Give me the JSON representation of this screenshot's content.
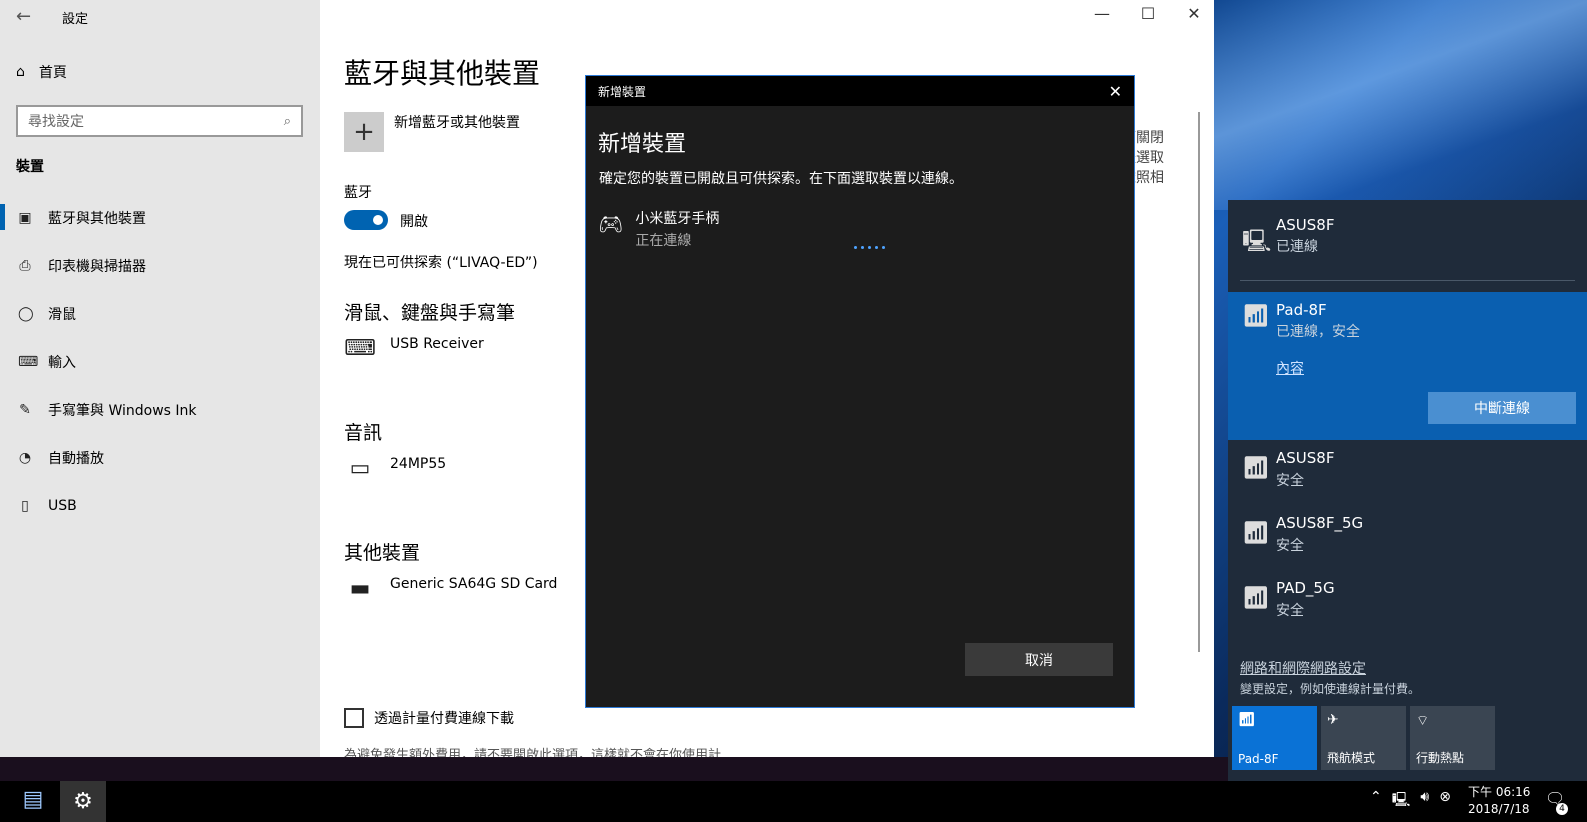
{
  "settings": {
    "window_title": "設定",
    "home_label": "首頁",
    "search_placeholder": "尋找設定",
    "section_title": "裝置",
    "nav_items": [
      {
        "label": "藍牙與其他裝置",
        "icon": "bluetooth-devices-icon"
      },
      {
        "label": "印表機與掃描器",
        "icon": "printer-icon"
      },
      {
        "label": "滑鼠",
        "icon": "mouse-icon"
      },
      {
        "label": "輸入",
        "icon": "keyboard-icon"
      },
      {
        "label": "手寫筆與 Windows Ink",
        "icon": "pen-icon"
      },
      {
        "label": "自動播放",
        "icon": "autoplay-icon"
      },
      {
        "label": "USB",
        "icon": "usb-icon"
      }
    ],
    "page_title": "藍牙與其他裝置",
    "add_device_label": "新增藍牙或其他裝置",
    "bluetooth_label": "藍牙",
    "bluetooth_state": "開啟",
    "discoverable_text": "現在已可供探索 (“LIVAQ-ED”)",
    "group_mouse_kb_pen": "滑鼠、鍵盤與手寫筆",
    "device_usb_receiver": "USB Receiver",
    "group_audio": "音訊",
    "device_monitor": "24MP55",
    "group_other": "其他裝置",
    "device_sdcard": "Generic SA64G SD Card",
    "metered_checkbox_label": "透過計量付費連線下載",
    "metered_truncated_text": "為避免發生額外費用，請不要開啟此選項，這樣就不會在你使用計",
    "right_snip_lines": [
      "下關閉",
      "後選取",
      "依照相"
    ]
  },
  "dialog": {
    "title": "新增裝置",
    "heading": "新增裝置",
    "description": "確定您的裝置已開啟且可供探索。在下面選取裝置以連線。",
    "device_name": "小米藍牙手柄",
    "device_status": "正在連線",
    "cancel_label": "取消"
  },
  "network": {
    "wired": {
      "name": "ASUS8F",
      "status": "已連線"
    },
    "active_wifi": {
      "name": "Pad-8F",
      "status": "已連線，安全",
      "properties_link": "內容",
      "disconnect_label": "中斷連線"
    },
    "wifi_list": [
      {
        "name": "ASUS8F",
        "status": "安全"
      },
      {
        "name": "ASUS8F_5G",
        "status": "安全"
      },
      {
        "name": "PAD_5G",
        "status": "安全"
      }
    ],
    "settings_link": "網路和網際網路設定",
    "settings_sub": "變更設定，例如使連線計量付費。",
    "quick_actions": [
      {
        "label": "Pad-8F",
        "icon": "wifi-icon",
        "on": true
      },
      {
        "label": "飛航模式",
        "icon": "airplane-icon",
        "on": false
      },
      {
        "label": "行動熱點",
        "icon": "hotspot-icon",
        "on": false
      }
    ]
  },
  "taskbar": {
    "clock_time": "下午 06:16",
    "clock_date": "2018/7/18",
    "notification_count": "4"
  },
  "colors": {
    "accent": "#0063b1",
    "flyout_bg": "#1f2b3a",
    "active_network": "#0a5fb0"
  }
}
